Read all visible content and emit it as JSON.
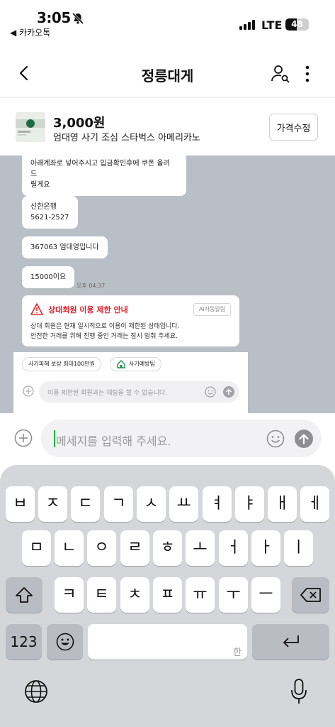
{
  "status_bar": {
    "time": "3:05",
    "back_app": "◀ 카카오톡",
    "network": "LTE",
    "battery_level": "48",
    "battery_fraction": 0.48
  },
  "header": {
    "title": "정릉대게",
    "icons": [
      "back-arrow-icon",
      "person-search-icon",
      "more-vertical-icon"
    ]
  },
  "product": {
    "price": "3,000원",
    "name": "엄대영 사기 조심 스타벅스 아메리카노",
    "edit_price_button": "가격수정"
  },
  "chat": {
    "messages": [
      {
        "lines": [
          "아래계좌로 넣어주시고 입금확인후에 쿠폰 올려 드",
          "릴게요"
        ]
      },
      {
        "lines": [
          "신한은행",
          "5621-2527"
        ]
      },
      {
        "lines": [
          "367063 엄대영입니다"
        ]
      },
      {
        "lines": [
          "15000이요"
        ],
        "timestamp": "오후 04:37"
      }
    ],
    "notice": {
      "title": "상대회원 이용 제한 안내",
      "badge": "AI자동알림",
      "body_lines": [
        "상대 회원은 현재 일시적으로 이용이 제한된 상태입니다.",
        "안전한 거래를 위해 진행 중인 거래는 잠시 멈춰 주세요."
      ]
    },
    "chips": [
      "사기피해 보상 최대100만원",
      "사기예방팁"
    ],
    "inner_input_placeholder": "이용 제한된 회원과는 채팅을 할 수 없습니다."
  },
  "composer": {
    "placeholder": "메세지를 입력해 주세요."
  },
  "keyboard": {
    "row1": [
      "ㅂ",
      "ㅈ",
      "ㄷ",
      "ㄱ",
      "ㅅ",
      "ㅛ",
      "ㅕ",
      "ㅑ",
      "ㅐ",
      "ㅔ"
    ],
    "row2": [
      "ㅁ",
      "ㄴ",
      "ㅇ",
      "ㄹ",
      "ㅎ",
      "ㅗ",
      "ㅓ",
      "ㅏ",
      "ㅣ"
    ],
    "row3": [
      "ㅋ",
      "ㅌ",
      "ㅊ",
      "ㅍ",
      "ㅠ",
      "ㅜ",
      "ㅡ"
    ],
    "numbers_key": "123",
    "space_hint": "한",
    "colors": {
      "background": "#d4d6da",
      "key": "#ffffff",
      "accent": "#1cb14a"
    }
  }
}
